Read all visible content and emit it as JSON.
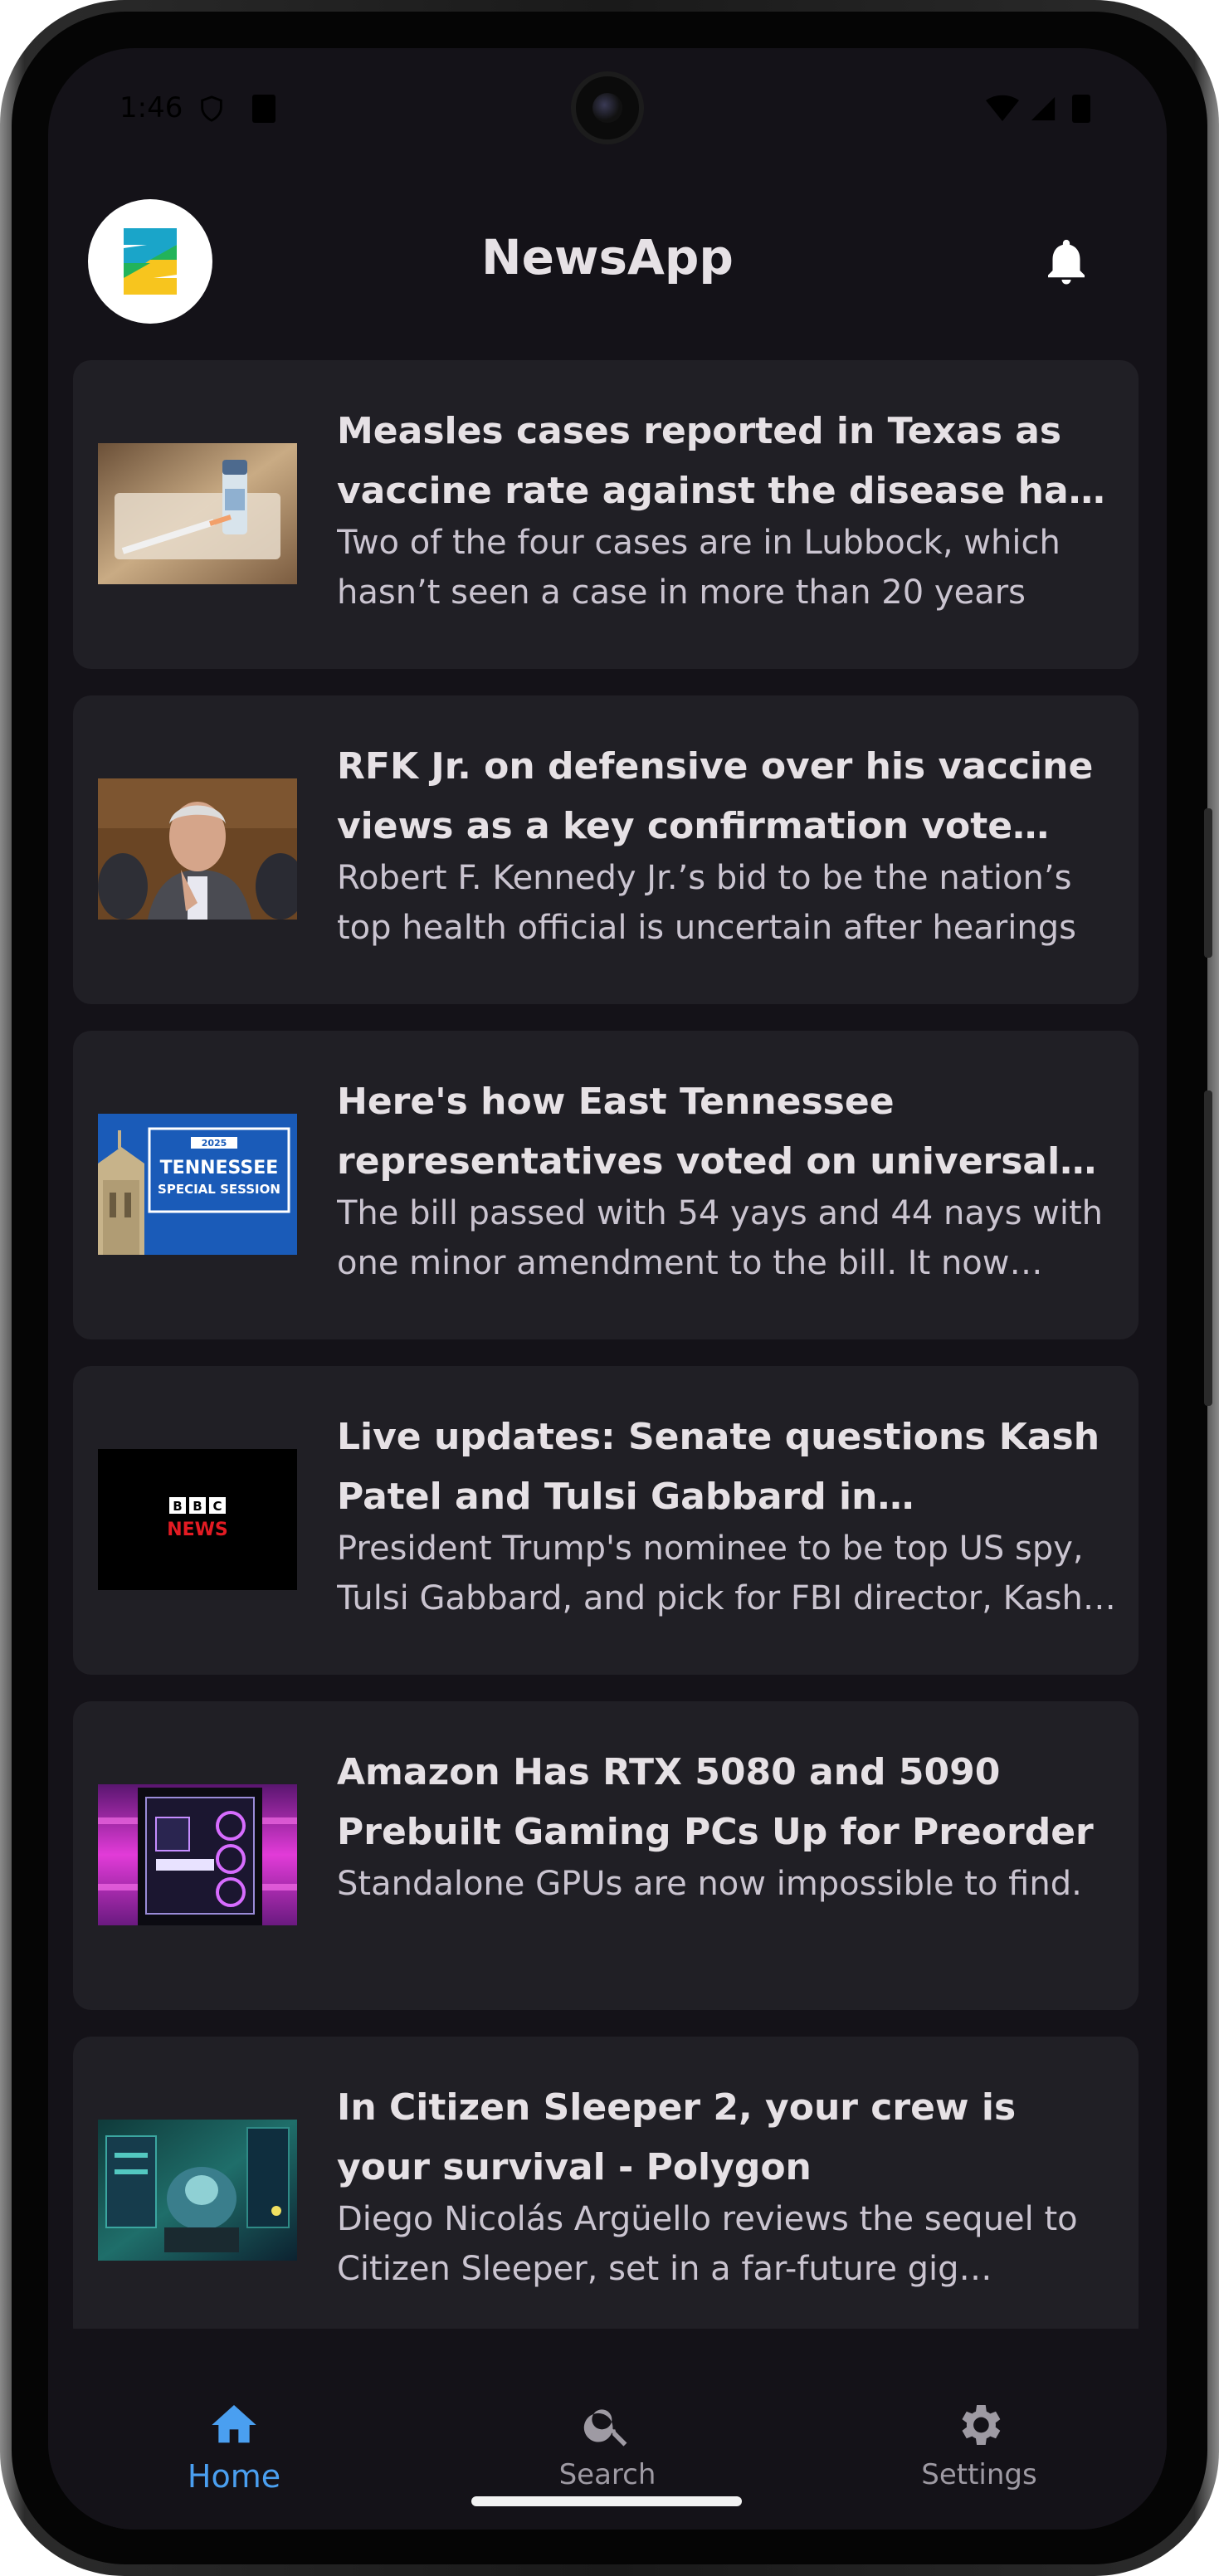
{
  "status_bar": {
    "time": "1:46"
  },
  "header": {
    "title": "NewsApp"
  },
  "articles": [
    {
      "title": "Measles cases reported in Texas as vaccine rate against the disease has dropped",
      "description": "Two of the four cases are in Lubbock, which hasn’t seen a case in more than 20 years",
      "image": "vaccine-vial-syringe"
    },
    {
      "title": "RFK Jr. on defensive over his vaccine views as a key confirmation vote looms",
      "description": "Robert F. Kennedy Jr.’s bid to be the nation’s top health official is uncertain after hearings",
      "image": "rfk-jr-portrait"
    },
    {
      "title": "Here's how East Tennessee representatives voted on universal school choice",
      "description": "The bill passed with 54 yays and 44 nays with one minor amendment to the bill. It now heads",
      "image": "tennessee-special-session",
      "image_text": {
        "year": "2025",
        "line1": "TENNESSEE",
        "line2": "SPECIAL SESSION"
      }
    },
    {
      "title": "Live updates: Senate questions Kash Patel and Tulsi Gabbard in confirmation hearings",
      "description": "President Trump's nominee to be top US spy, Tulsi Gabbard, and pick for FBI director, Kash Patel",
      "image": "bbc-news-logo",
      "image_text": {
        "letters": [
          "B",
          "B",
          "C"
        ],
        "news": "NEWS"
      }
    },
    {
      "title": "Amazon Has RTX 5080 and 5090 Prebuilt Gaming PCs Up for Preorder",
      "description": "Standalone GPUs are now impossible to find.",
      "image": "gaming-pc-case"
    },
    {
      "title": "In Citizen Sleeper 2, your crew is your survival - Polygon",
      "description": "Diego Nicolás Argüello reviews the sequel to Citizen Sleeper, set in a far-future gig economy",
      "image": "citizen-sleeper-art"
    }
  ],
  "nav": {
    "items": [
      {
        "label": "Home",
        "icon": "home-icon",
        "active": true
      },
      {
        "label": "Search",
        "icon": "search-icon",
        "active": false
      },
      {
        "label": "Settings",
        "icon": "gear-icon",
        "active": false
      }
    ]
  },
  "colors": {
    "background": "#141218",
    "card": "#201f25",
    "accent": "#4a9ff0",
    "text_primary": "#e6e1e5",
    "text_secondary": "#cac4d0",
    "nav_inactive": "#9e9aa3"
  }
}
